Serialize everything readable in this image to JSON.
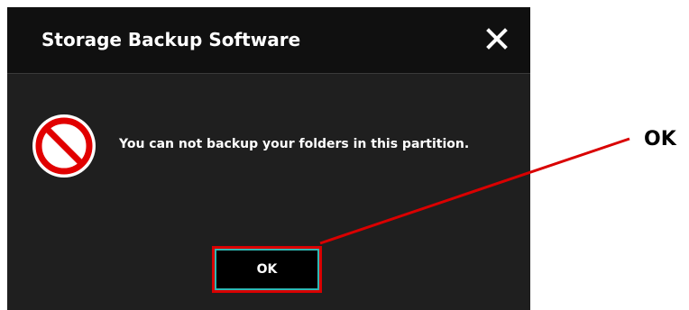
{
  "dialog": {
    "title": "Storage Backup Software",
    "message": "You can not backup your folders in this partition.",
    "ok_label": "OK",
    "close_icon": "close-icon",
    "status_icon": "prohibited-icon"
  },
  "annotation": {
    "label": "OK",
    "color": "#d90000"
  },
  "colors": {
    "dialog_background": "#1f1f1f",
    "titlebar_background": "#101010",
    "button_border": "#2fb7b3",
    "prohibit_red": "#e10000"
  }
}
